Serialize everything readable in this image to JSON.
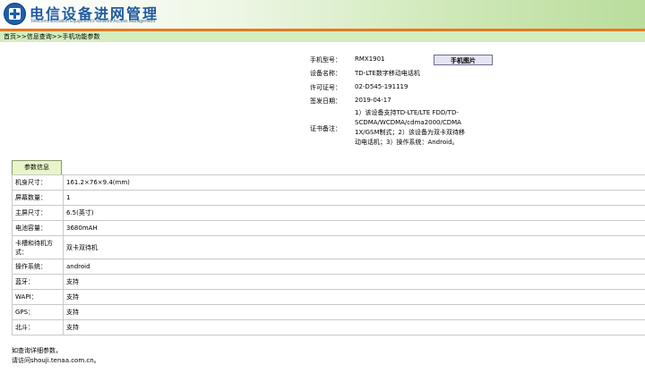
{
  "header": {
    "title_cn": "电信设备进网管理",
    "title_en": "Telecommunication Equipment's Network Access Management"
  },
  "breadcrumb": "首页>>信息查询>>手机功能参数",
  "certificate": {
    "model_label": "手机型号：",
    "model_value": "RMX1901",
    "photo_button": "手机图片",
    "device_label": "设备名称：",
    "device_value": "TD-LTE数字移动电话机",
    "license_label": "许可证号：",
    "license_value": "02-D545-191119",
    "date_label": "签发日期：",
    "date_value": "2019-04-17",
    "remarks_label": "证书备注：",
    "remarks_line1": "1）该设备支持TD-LTE/LTE FDD/TD-",
    "remarks_line2": "SCDMA/WCDMA/cdma2000/CDMA",
    "remarks_line3": "1X/GSM制式；2）该设备为双卡双待移",
    "remarks_line4": "动电话机；3）操作系统：Android。"
  },
  "params": {
    "section_title": "参数信息",
    "rows": [
      {
        "label": "机身尺寸：",
        "value": "161.2×76×9.4(mm)"
      },
      {
        "label": "屏幕数量：",
        "value": "1"
      },
      {
        "label": "主屏尺寸：",
        "value": "6.5(英寸)"
      },
      {
        "label": "电池容量：",
        "value": "3680mAH"
      },
      {
        "label": "卡槽和待机方式：",
        "value": "双卡双待机"
      },
      {
        "label": "操作系统：",
        "value": "android"
      },
      {
        "label": "蓝牙：",
        "value": "支持"
      },
      {
        "label": "WAPI：",
        "value": "支持"
      },
      {
        "label": "GPS：",
        "value": "支持"
      },
      {
        "label": "北斗：",
        "value": "支持"
      }
    ]
  },
  "footer": {
    "line1": "如查询详细参数，",
    "line2": "请访问shouji.tenaa.com.cn。"
  }
}
